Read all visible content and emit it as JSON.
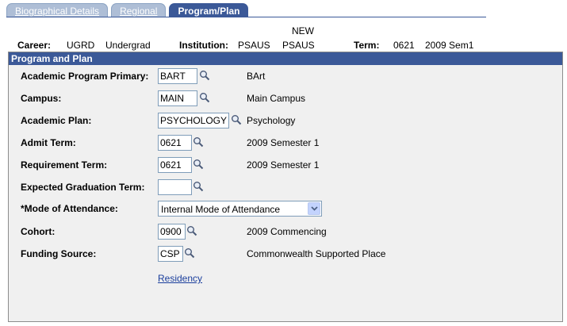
{
  "tabs": [
    {
      "label": "Biographical Details",
      "active": false
    },
    {
      "label": "Regional",
      "active": false
    },
    {
      "label": "Program/Plan",
      "active": true
    }
  ],
  "header": {
    "status": "NEW",
    "career_label": "Career:",
    "career_code": "UGRD",
    "career_desc": "Undergrad",
    "institution_label": "Institution:",
    "institution_code": "PSAUS",
    "institution_desc": "PSAUS",
    "term_label": "Term:",
    "term_code": "0621",
    "term_desc": "2009 Sem1"
  },
  "group": {
    "title": "Program and Plan"
  },
  "fields": {
    "academic_program": {
      "label": "Academic Program Primary:",
      "value": "BART",
      "desc": "BArt"
    },
    "campus": {
      "label": "Campus:",
      "value": "MAIN",
      "desc": "Main Campus"
    },
    "academic_plan": {
      "label": "Academic Plan:",
      "value": "PSYCHOLOGY",
      "desc": "Psychology"
    },
    "admit_term": {
      "label": "Admit Term:",
      "value": "0621",
      "desc": "2009 Semester 1"
    },
    "requirement_term": {
      "label": "Requirement Term:",
      "value": "0621",
      "desc": "2009 Semester 1"
    },
    "expected_grad_term": {
      "label": "Expected Graduation Term:",
      "value": ""
    },
    "mode_of_attendance": {
      "label": "*Mode of Attendance:",
      "value": "Internal Mode of Attendance"
    },
    "cohort": {
      "label": "Cohort:",
      "value": "0900",
      "desc": "2009 Commencing"
    },
    "funding_source": {
      "label": "Funding Source:",
      "value": "CSP",
      "desc": "Commonwealth Supported Place"
    }
  },
  "links": {
    "residency": "Residency"
  },
  "colors": {
    "accent": "#3b5998",
    "tab_inactive": "#aebed6",
    "panel_bg": "#f0f0f0",
    "link": "#1a3e9c"
  }
}
